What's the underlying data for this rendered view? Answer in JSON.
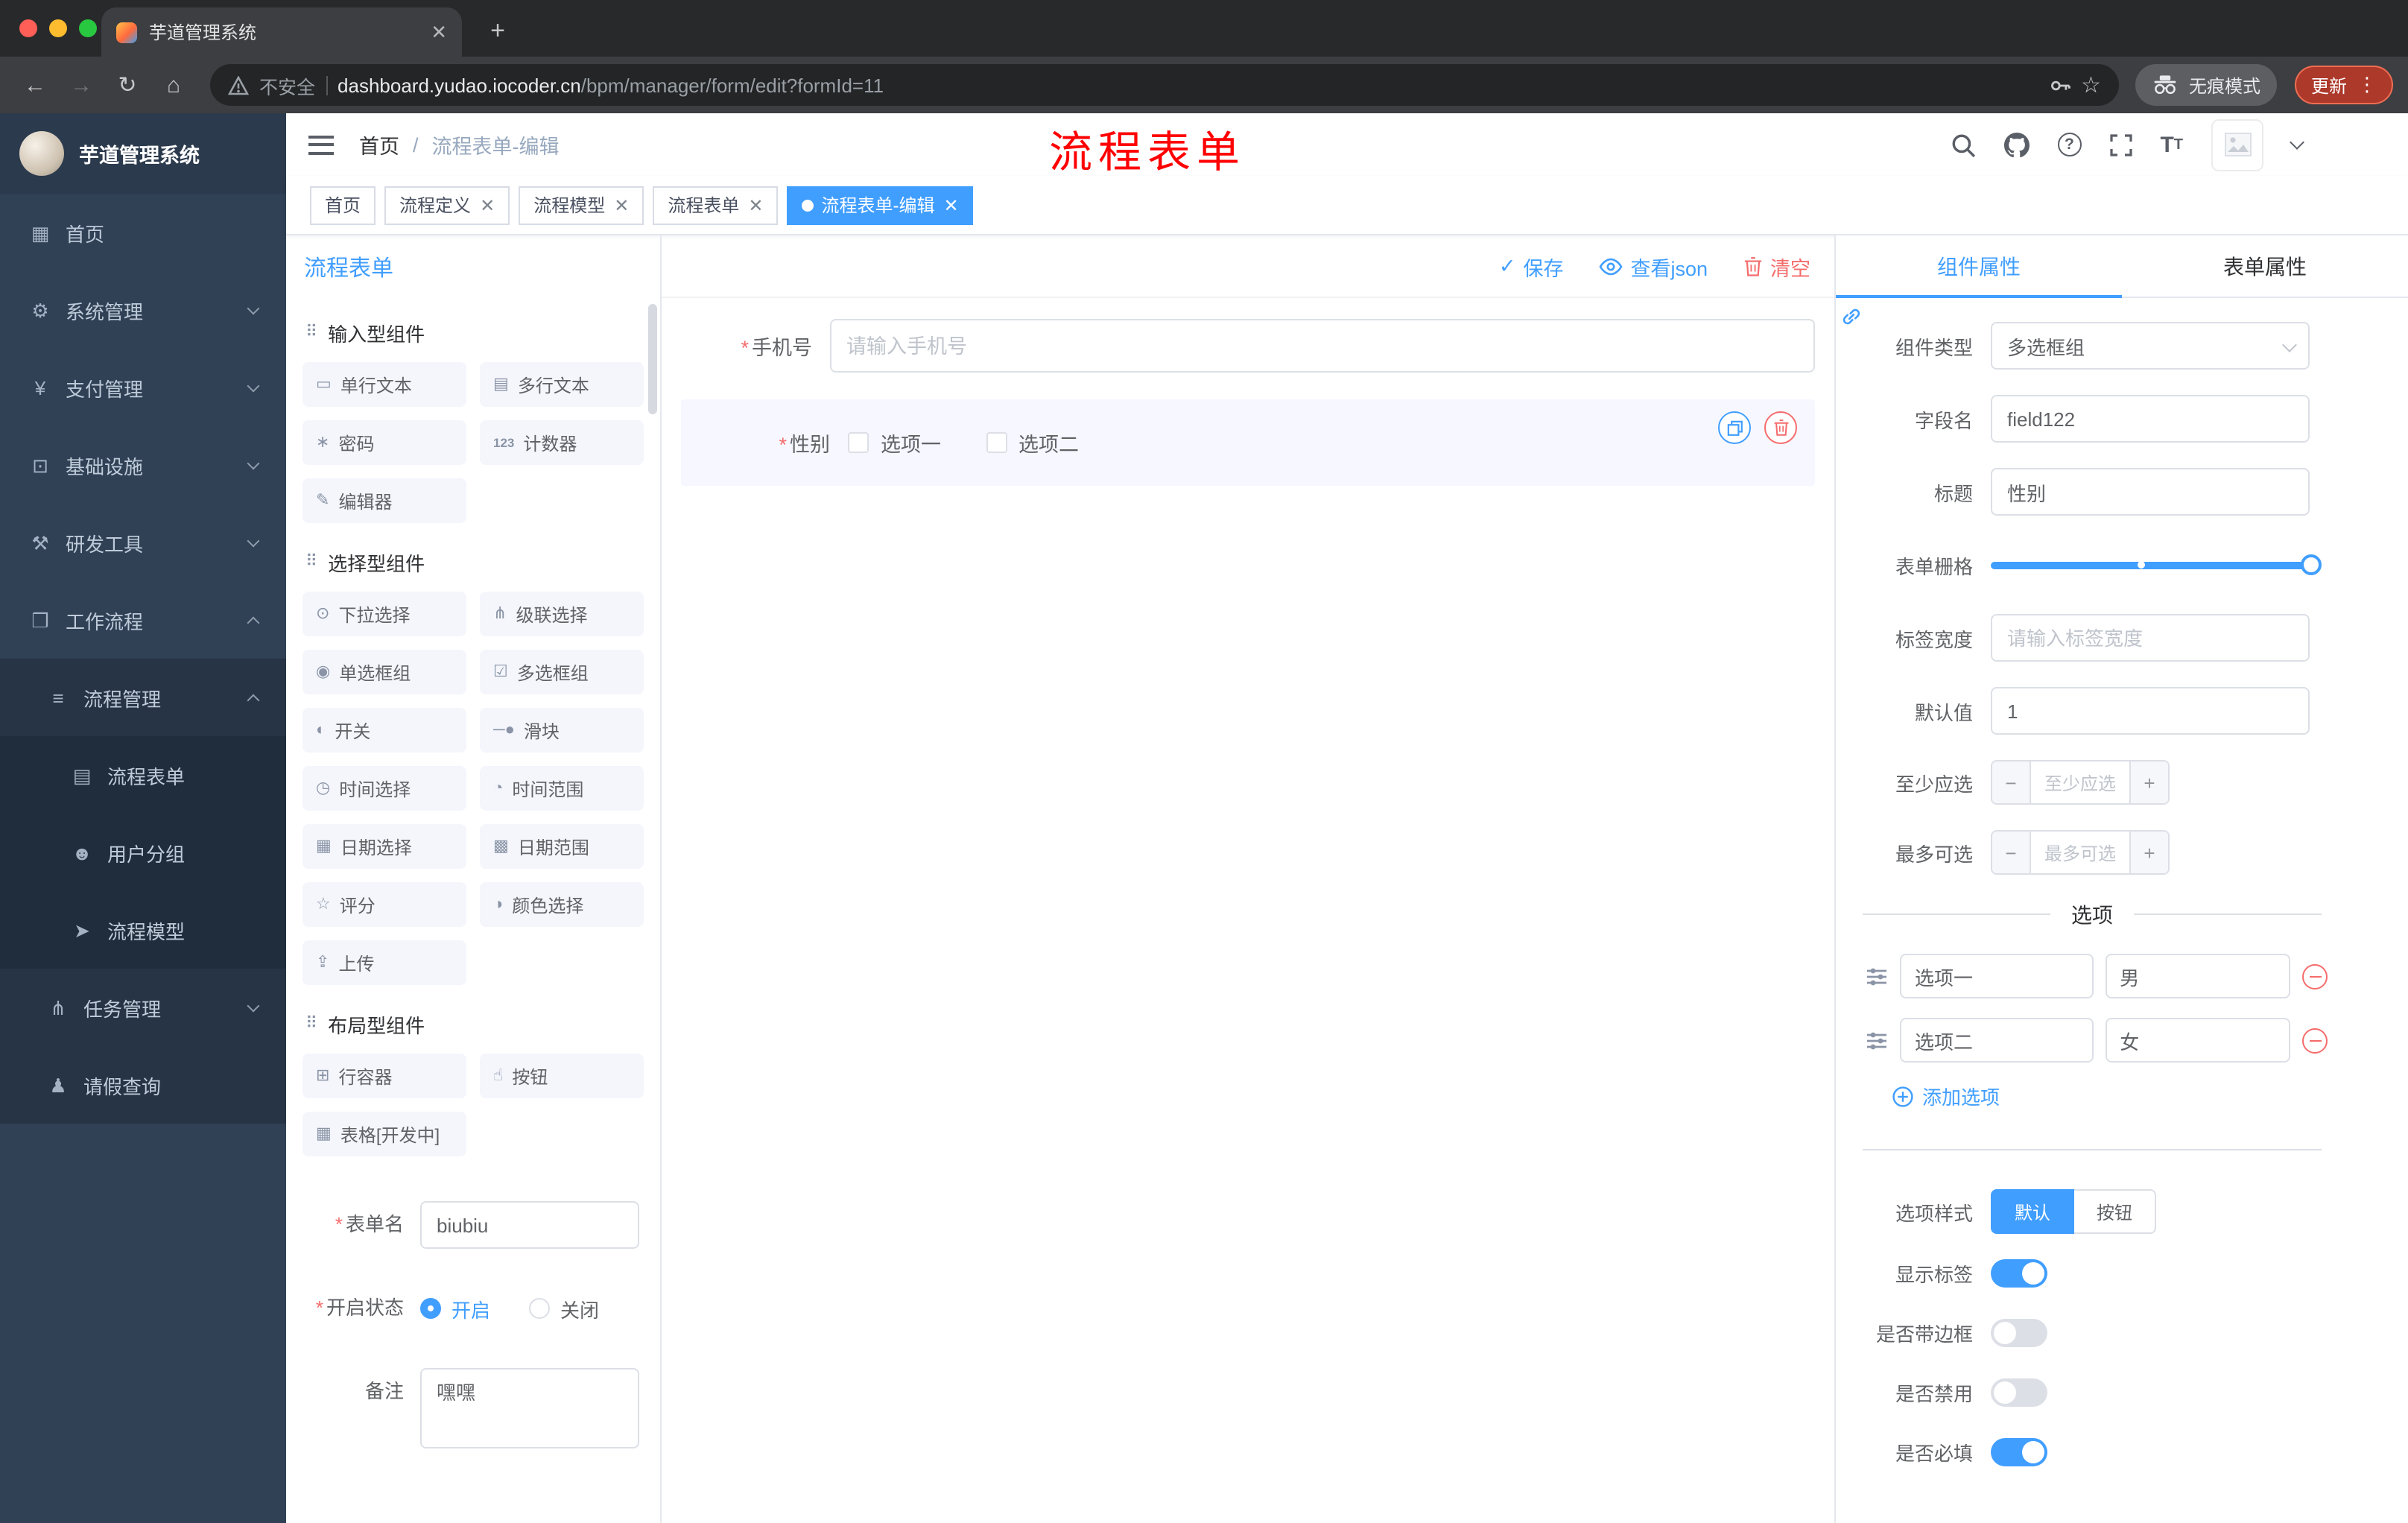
{
  "colors": {
    "accent": "#409eff",
    "danger": "#f56c6c",
    "sidebar_bg": "#304156",
    "annotation": "#ff0000",
    "active_tag_bg": "#409eff"
  },
  "browser": {
    "tab_title": "芋道管理系统",
    "security_label": "不安全",
    "url_domain": "dashboard.yudao.iocoder.cn",
    "url_path": "/bpm/manager/form/edit?formId=11",
    "incognito_label": "无痕模式",
    "update_label": "更新"
  },
  "sidebar": {
    "app_title": "芋道管理系统",
    "items": [
      {
        "label": "首页",
        "icon": "dashboard-icon"
      },
      {
        "label": "系统管理",
        "icon": "gear-icon"
      },
      {
        "label": "支付管理",
        "icon": "payment-icon"
      },
      {
        "label": "基础设施",
        "icon": "infrastructure-icon"
      },
      {
        "label": "研发工具",
        "icon": "tools-icon"
      },
      {
        "label": "工作流程",
        "icon": "workflow-icon"
      },
      {
        "label": "流程管理",
        "icon": "process-manage-icon"
      },
      {
        "label": "流程表单",
        "icon": "process-form-icon"
      },
      {
        "label": "用户分组",
        "icon": "user-group-icon"
      },
      {
        "label": "流程模型",
        "icon": "process-model-icon"
      },
      {
        "label": "任务管理",
        "icon": "task-manage-icon"
      },
      {
        "label": "请假查询",
        "icon": "leave-query-icon"
      }
    ]
  },
  "navbar": {
    "breadcrumb_home": "首页",
    "breadcrumb_separator": "/",
    "breadcrumb_current": "流程表单-编辑",
    "annotation": "流程表单"
  },
  "tags_view": {
    "tags": [
      {
        "label": "首页",
        "closable": false,
        "active": false
      },
      {
        "label": "流程定义",
        "closable": true,
        "active": false
      },
      {
        "label": "流程模型",
        "closable": true,
        "active": false
      },
      {
        "label": "流程表单",
        "closable": true,
        "active": false
      },
      {
        "label": "流程表单-编辑",
        "closable": true,
        "active": true
      }
    ]
  },
  "designer": {
    "form_title": "流程表单",
    "actions": {
      "save": "保存",
      "view_json": "查看json",
      "clear": "清空"
    },
    "palette": {
      "groups": [
        {
          "title": "输入型组件",
          "items": [
            {
              "label": "单行文本",
              "icon": "input-icon"
            },
            {
              "label": "多行文本",
              "icon": "textarea-icon"
            },
            {
              "label": "密码",
              "icon": "password-icon"
            },
            {
              "label": "计数器",
              "icon": "counter-icon"
            },
            {
              "label": "编辑器",
              "icon": "editor-icon"
            }
          ]
        },
        {
          "title": "选择型组件",
          "items": [
            {
              "label": "下拉选择",
              "icon": "select-icon"
            },
            {
              "label": "级联选择",
              "icon": "cascader-icon"
            },
            {
              "label": "单选框组",
              "icon": "radio-group-icon"
            },
            {
              "label": "多选框组",
              "icon": "checkbox-group-icon"
            },
            {
              "label": "开关",
              "icon": "switch-icon"
            },
            {
              "label": "滑块",
              "icon": "slider-icon"
            },
            {
              "label": "时间选择",
              "icon": "time-icon"
            },
            {
              "label": "时间范围",
              "icon": "time-range-icon"
            },
            {
              "label": "日期选择",
              "icon": "date-icon"
            },
            {
              "label": "日期范围",
              "icon": "date-range-icon"
            },
            {
              "label": "评分",
              "icon": "rate-icon"
            },
            {
              "label": "颜色选择",
              "icon": "color-icon"
            },
            {
              "label": "上传",
              "icon": "upload-icon"
            }
          ]
        },
        {
          "title": "布局型组件",
          "items": [
            {
              "label": "行容器",
              "icon": "row-icon"
            },
            {
              "label": "按钮",
              "icon": "button-icon"
            },
            {
              "label": "表格[开发中]",
              "icon": "table-icon"
            }
          ]
        }
      ]
    },
    "meta": {
      "form_name_label": "表单名",
      "form_name_value": "biubiu",
      "status_label": "开启状态",
      "status_on": "开启",
      "status_off": "关闭",
      "status_selected": "开启",
      "remark_label": "备注",
      "remark_value": "嘿嘿"
    },
    "canvas": {
      "phone_label": "手机号",
      "phone_placeholder": "请输入手机号",
      "gender_label": "性别",
      "gender_option1": "选项一",
      "gender_option2": "选项二"
    }
  },
  "props": {
    "tabs": {
      "component": "组件属性",
      "form": "表单属性"
    },
    "active_tab": "组件属性",
    "component_type": {
      "label": "组件类型",
      "value": "多选框组"
    },
    "field_name": {
      "label": "字段名",
      "value": "field122"
    },
    "title": {
      "label": "标题",
      "value": "性别"
    },
    "grid": {
      "label": "表单栅格",
      "value_percent": 100,
      "stop_percent": 47
    },
    "label_width": {
      "label": "标签宽度",
      "placeholder": "请输入标签宽度"
    },
    "default_value": {
      "label": "默认值",
      "value": "1"
    },
    "min_select": {
      "label": "至少应选",
      "placeholder": "至少应选"
    },
    "max_select": {
      "label": "最多可选",
      "placeholder": "最多可选"
    },
    "options_title": "选项",
    "options": [
      {
        "label": "选项一",
        "value": "男"
      },
      {
        "label": "选项二",
        "value": "女"
      }
    ],
    "add_option": "添加选项",
    "option_style": {
      "label": "选项样式",
      "choices": [
        "默认",
        "按钮"
      ],
      "selected": "默认"
    },
    "switches": [
      {
        "label": "显示标签",
        "on": true
      },
      {
        "label": "是否带边框",
        "on": false
      },
      {
        "label": "是否禁用",
        "on": false
      },
      {
        "label": "是否必填",
        "on": true
      }
    ]
  }
}
